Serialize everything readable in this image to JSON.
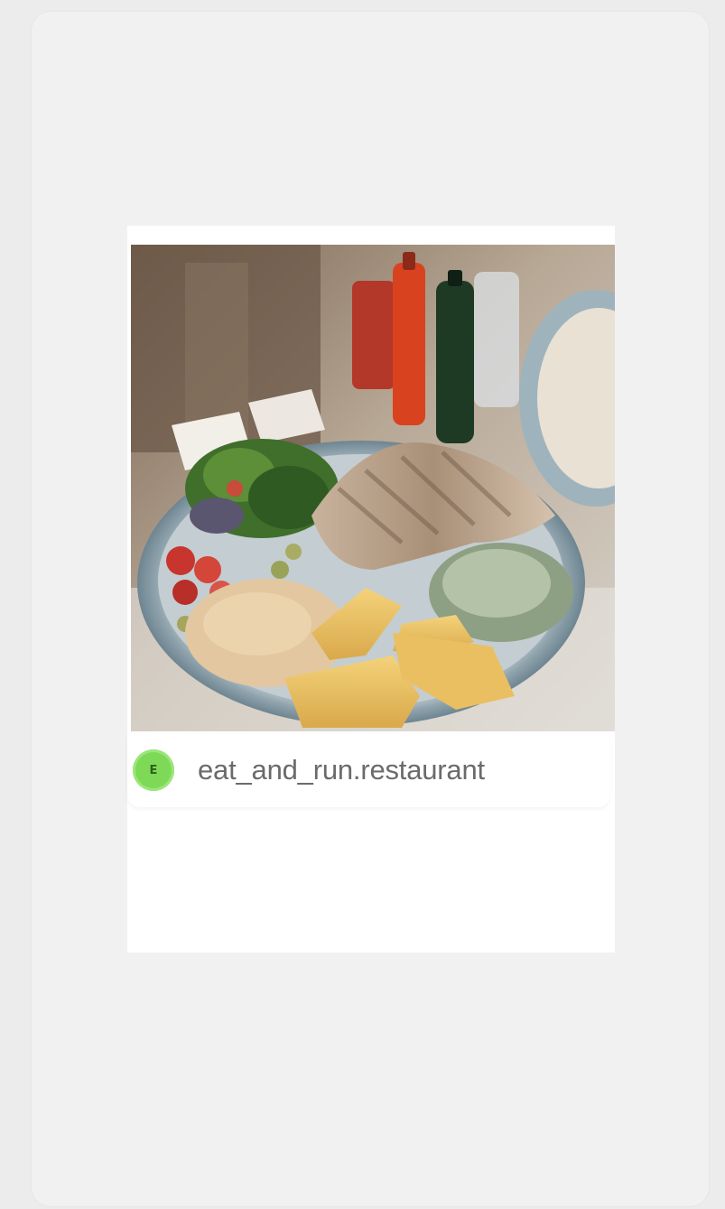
{
  "post": {
    "image_alt": "food-photo",
    "account": {
      "initial": "E",
      "name": "eat_and_run.restaurant",
      "avatar_color": "#7ed957"
    }
  }
}
